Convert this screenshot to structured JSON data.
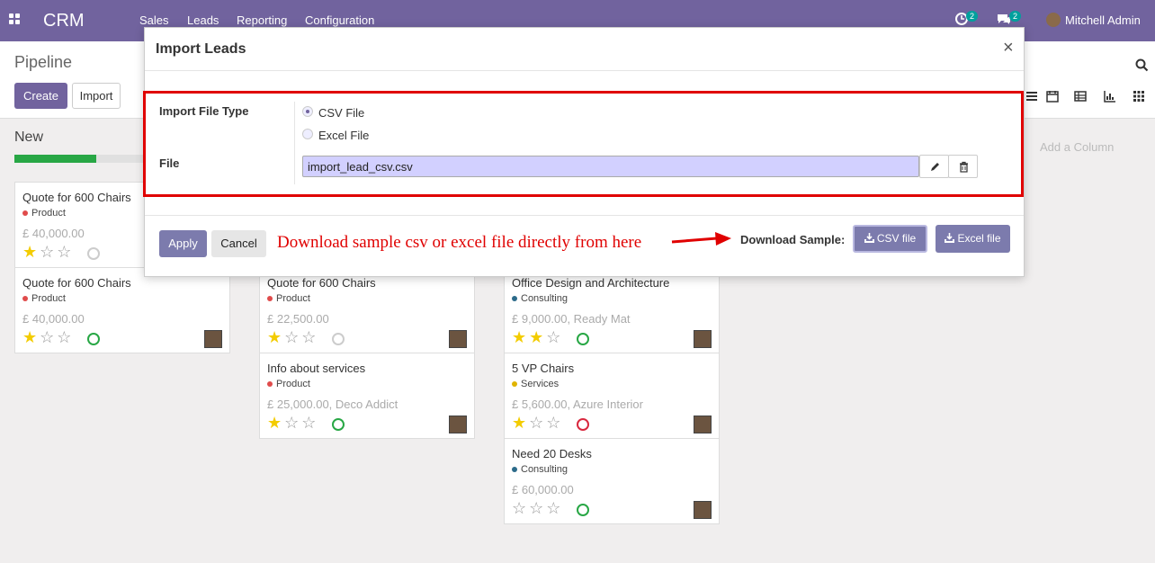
{
  "navbar": {
    "brand": "CRM",
    "menu": [
      "Sales",
      "Leads",
      "Reporting",
      "Configuration"
    ],
    "activity_badge": "2",
    "message_badge": "2",
    "user_name": "Mitchell Admin"
  },
  "control_panel": {
    "title": "Pipeline",
    "create_label": "Create",
    "import_label": "Import"
  },
  "kanban": {
    "column_title": "New",
    "progress_fraction": 0.38,
    "add_column_label": "Add a Column",
    "cards": [
      {
        "title": "Quote for 600 Chairs",
        "tag": "Product",
        "tag_color": "#e04b4b",
        "amount": "£ 40,000.00",
        "stars": 1,
        "activity": "grey"
      },
      {
        "title": "Quote for 600 Chairs",
        "tag": "Product",
        "tag_color": "#e04b4b",
        "amount": "£ 40,000.00",
        "stars": 1,
        "activity": "green"
      },
      {
        "title": "Quote for 600 Chairs",
        "tag": "Product",
        "tag_color": "#e04b4b",
        "amount": "£ 22,500.00",
        "stars": 1,
        "activity": "grey"
      },
      {
        "title": "Info about services",
        "tag": "Product",
        "tag_color": "#e04b4b",
        "amount": "£ 25,000.00, Deco Addict",
        "stars": 1,
        "activity": "green"
      },
      {
        "title": "Office Design and Architecture",
        "tag": "Consulting",
        "tag_color": "#2c6b8a",
        "amount": "£ 9,000.00, Ready Mat",
        "stars": 2,
        "activity": "green"
      },
      {
        "title": "5 VP Chairs",
        "tag": "Services",
        "tag_color": "#e0b400",
        "amount": "£ 5,600.00, Azure Interior",
        "stars": 1,
        "activity": "red"
      },
      {
        "title": "Need 20 Desks",
        "tag": "Consulting",
        "tag_color": "#2c6b8a",
        "amount": "£ 60,000.00",
        "stars": 0,
        "activity": "green"
      }
    ]
  },
  "modal": {
    "title": "Import Leads",
    "close": "×",
    "file_type_label": "Import File Type",
    "options": [
      "CSV File",
      "Excel File"
    ],
    "selected_option": "CSV File",
    "file_label": "File",
    "file_value": "import_lead_csv.csv",
    "apply_label": "Apply",
    "cancel_label": "Cancel",
    "annotation": "Download sample csv or excel file directly from here",
    "download_label": "Download Sample:",
    "csv_button": "CSV file",
    "excel_button": "Excel file"
  },
  "colors": {
    "brand": "#71639e",
    "highlight": "#e00000",
    "annotation": "#e00000",
    "file_input_bg": "#d2d0ff"
  }
}
